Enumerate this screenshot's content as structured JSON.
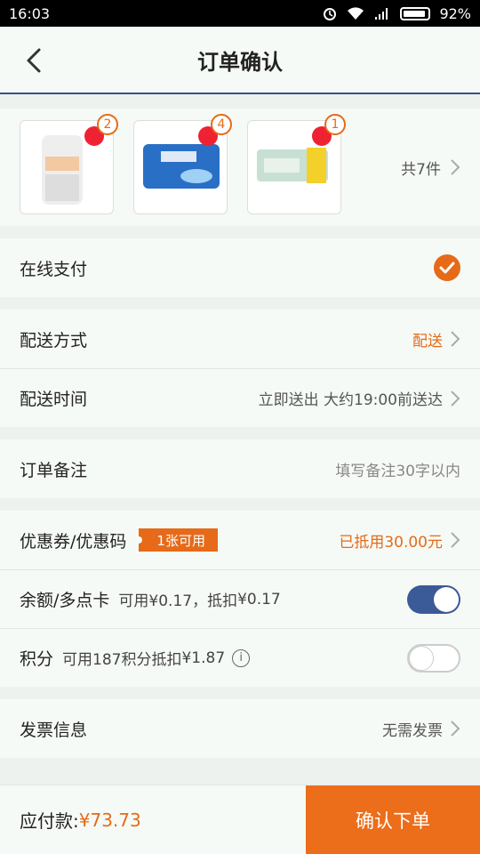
{
  "status": {
    "time": "16:03",
    "battery": "92%"
  },
  "header": {
    "title": "订单确认"
  },
  "products": {
    "items": [
      {
        "qty": "2"
      },
      {
        "qty": "4"
      },
      {
        "qty": "1"
      }
    ],
    "count_text": "共7件"
  },
  "payment": {
    "label": "在线支付"
  },
  "delivery": {
    "method_label": "配送方式",
    "method_value": "配送",
    "time_label": "配送时间",
    "time_value": "立即送出 大约19:00前送达"
  },
  "note": {
    "label": "订单备注",
    "placeholder": "填写备注30字以内"
  },
  "coupon": {
    "label": "优惠券/优惠码",
    "tag": "1张可用",
    "value": "已抵用30.00元"
  },
  "balance": {
    "label": "余额/多点卡",
    "sub": "可用¥0.17，抵扣",
    "amount": "¥0.17",
    "enabled": true
  },
  "points": {
    "label": "积分",
    "sub": "可用187积分抵扣",
    "amount": "¥1.87",
    "info_icon": "i",
    "enabled": false
  },
  "invoice": {
    "label": "发票信息",
    "value": "无需发票"
  },
  "footer": {
    "total_label": "应付款:",
    "total_value": "¥73.73",
    "submit_label": "确认下单"
  },
  "colors": {
    "accent": "#e66a18",
    "toggle_on": "#3a5a98"
  }
}
